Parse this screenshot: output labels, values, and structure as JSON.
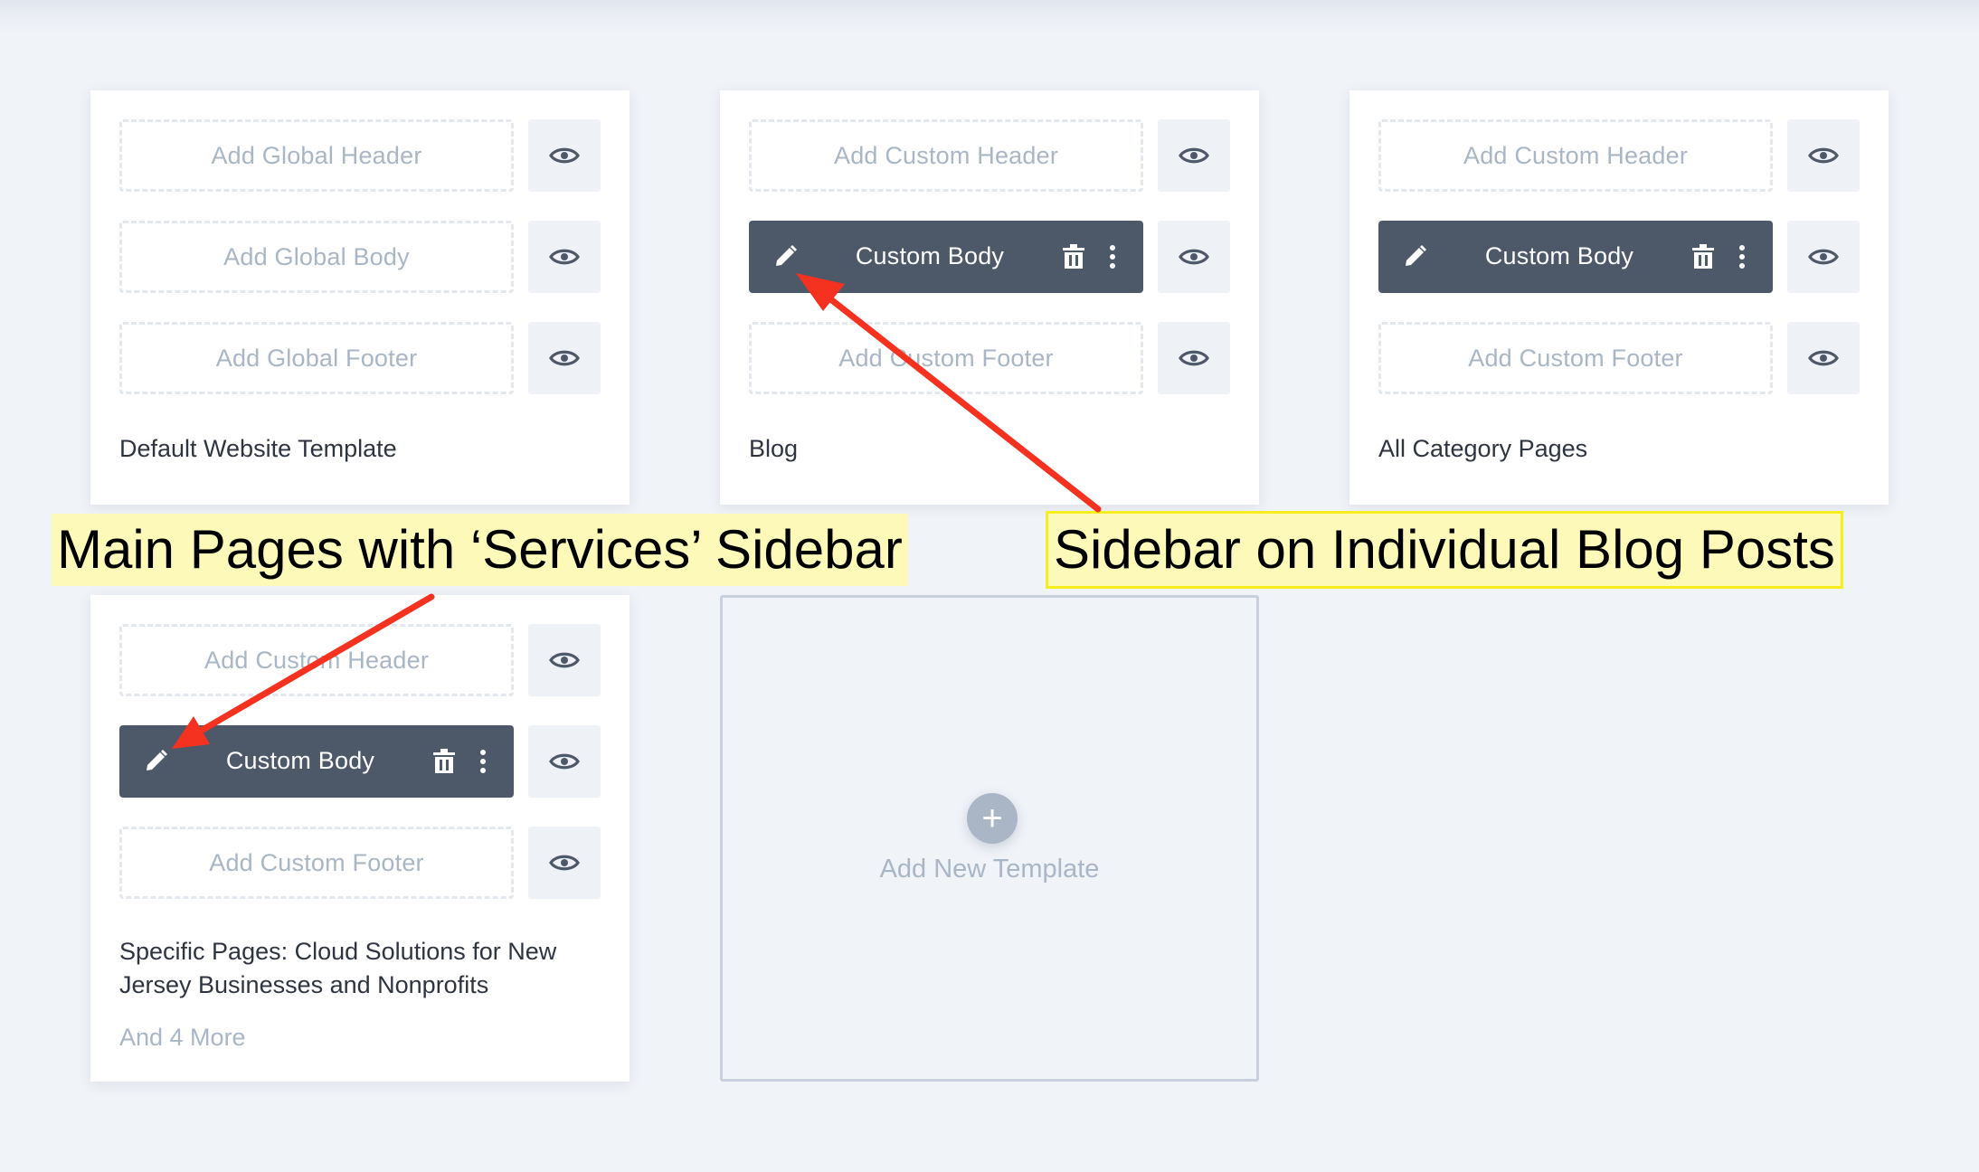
{
  "colors": {
    "background": "#f0f3f8",
    "card": "#ffffff",
    "filled_slot": "#4d5868",
    "muted_text": "#a9b6c6",
    "arrow": "#f5321f",
    "highlight": "#fdf9b8"
  },
  "icons": {
    "preview": "eye-icon",
    "edit": "pencil-icon",
    "delete": "trash-icon",
    "more": "kebab-icon",
    "add": "plus-icon"
  },
  "cards": [
    {
      "header": "Add Global Header",
      "body": "Add Global Body",
      "footer": "Add Global Footer",
      "title": "Default Website Template"
    },
    {
      "header": "Add Custom Header",
      "body": "Custom Body",
      "footer": "Add Custom Footer",
      "title": "Blog"
    },
    {
      "header": "Add Custom Header",
      "body": "Custom Body",
      "footer": "Add Custom Footer",
      "title": "All Category Pages"
    },
    {
      "header": "Add Custom Header",
      "body": "Custom Body",
      "footer": "Add Custom Footer",
      "title_line1": "Specific Pages: Cloud Solutions for New",
      "title_line2": "Jersey Businesses and Nonprofits",
      "more": "And 4 More"
    }
  ],
  "new_template": {
    "label": "Add New Template",
    "icon": "+"
  },
  "annotations": {
    "left": "Main Pages with ‘Services’ Sidebar",
    "right": "Sidebar on Individual Blog Posts"
  }
}
